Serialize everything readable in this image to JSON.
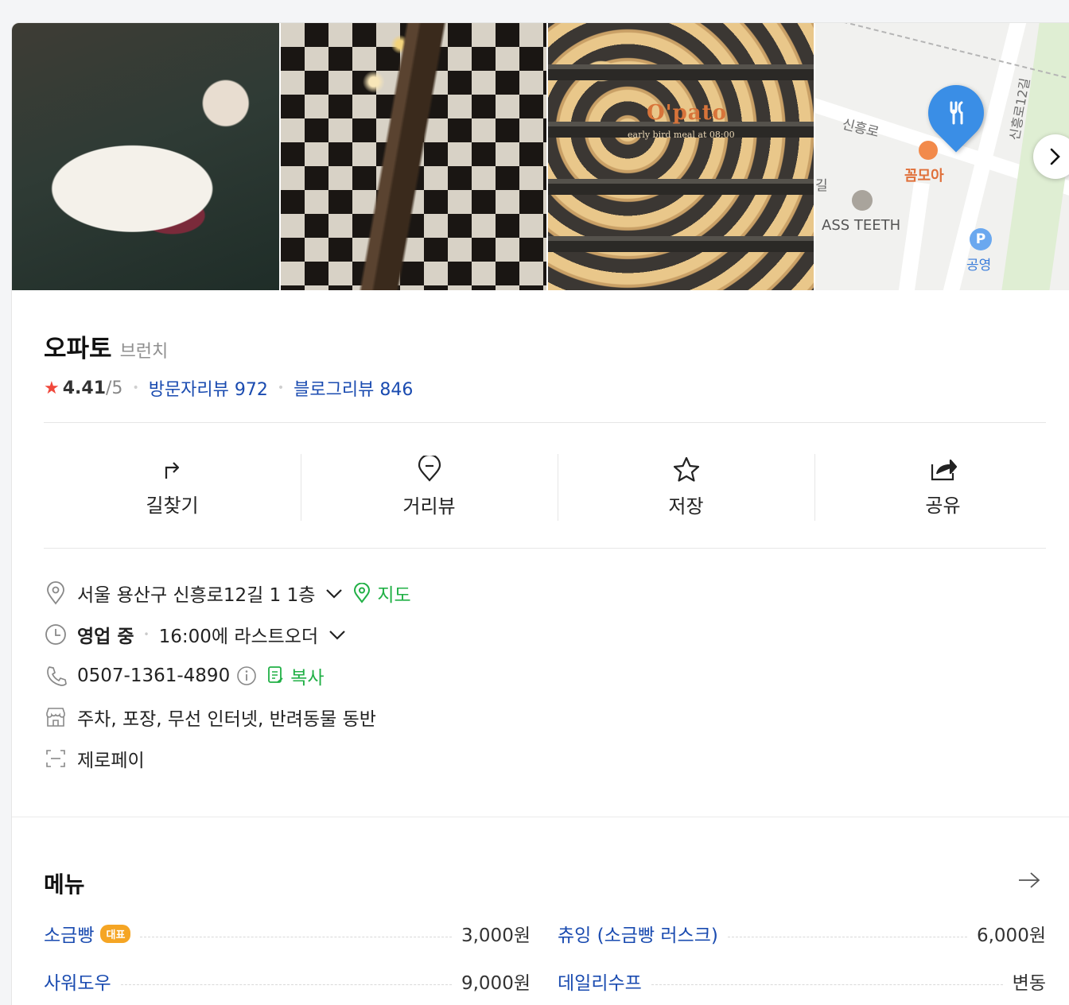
{
  "photos": {
    "photo3_brand": "O'pato",
    "photo3_tagline": "early bird meal at 08:00",
    "map_labels": {
      "road1": "신흥로",
      "road2": "신흥로12길",
      "road3": "길",
      "poi1": "꼼모아",
      "poi2": "ASS TEETH",
      "poi3": "공영",
      "parking": "P"
    }
  },
  "place": {
    "name": "오파토",
    "category": "브런치",
    "rating": "4.41",
    "rating_max": "/5",
    "visitor_reviews": "방문자리뷰 972",
    "blog_reviews": "블로그리뷰 846"
  },
  "actions": [
    {
      "label": "길찾기",
      "icon": "directions-icon"
    },
    {
      "label": "거리뷰",
      "icon": "street-view-icon"
    },
    {
      "label": "저장",
      "icon": "star-icon"
    },
    {
      "label": "공유",
      "icon": "share-icon"
    }
  ],
  "details": {
    "address": "서울 용산구 신흥로12길 1 1층",
    "map_link": "지도",
    "status": "영업 중",
    "last_order": "16:00에 라스트오더",
    "phone": "0507-1361-4890",
    "copy_link": "복사",
    "amenities": "주차, 포장, 무선 인터넷, 반려동물 동반",
    "payment": "제로페이"
  },
  "menu": {
    "title": "메뉴",
    "items": [
      {
        "name": "소금빵",
        "badge": "대표",
        "price": "3,000원"
      },
      {
        "name": "츄잉 (소금빵 러스크)",
        "price": "6,000원"
      },
      {
        "name": "사워도우",
        "price": "9,000원"
      },
      {
        "name": "데일리수프",
        "price": "변동"
      }
    ]
  },
  "colors": {
    "accent_blue": "#1a4bb0",
    "accent_green": "#21b046",
    "star_red": "#f0473b",
    "badge_orange": "#f5a524",
    "pin_blue": "#3a8ee6"
  }
}
